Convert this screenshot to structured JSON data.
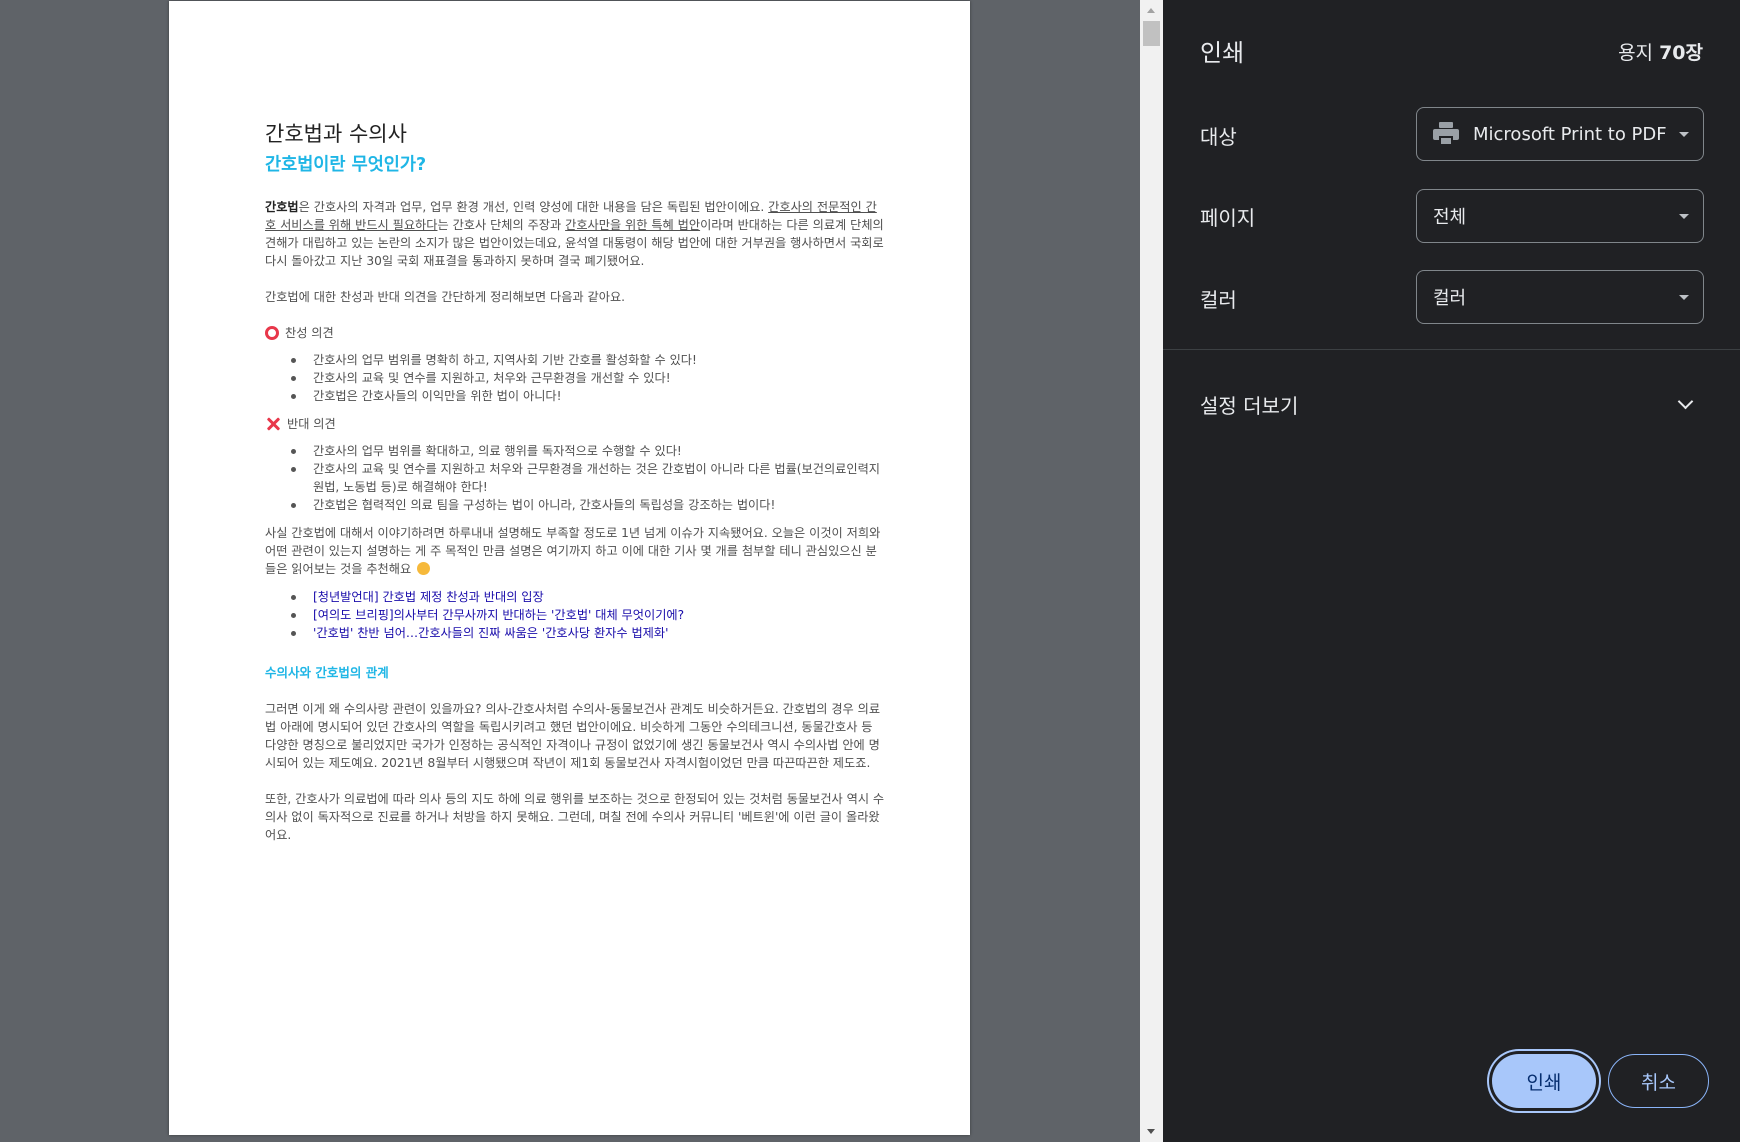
{
  "document": {
    "title": "간호법과 수의사",
    "heading": "간호법이란 무엇인가?",
    "intro": {
      "bold_term": "간호법",
      "part1": "은 간호사의 자격과 업무, 업무 환경 개선, 인력 양성에 대한 내용을 담은 독립된 법안이에요. ",
      "link1": "간호사의 전문적인 간호 서비스를 위해 반드시 필요하다",
      "part2": "는 간호사 단체의 주장과 ",
      "link2": "간호사만을 위한 특혜 법안",
      "part3": "이라며 반대하는 다른 의료계 단체의 견해가 대립하고 있는 논란의 소지가 많은 법안이었는데요, 윤석열 대통령이 해당 법안에 대한 거부권을 행사하면서 국회로 다시 돌아갔고 지난 30일 국회 재표결을 통과하지 못하며 결국 폐기됐어요."
    },
    "summary": "간호법에 대한 찬성과 반대 의견을 간단하게 정리해보면 다음과 같아요.",
    "pro_heading": "찬성 의견",
    "pro_items": [
      "간호사의 업무 범위를 명확히 하고, 지역사회 기반 간호를 활성화할 수 있다!",
      "간호사의 교육 및 연수를 지원하고, 처우와 근무환경을 개선할 수 있다!",
      "간호법은 간호사들의 이익만을 위한 법이 아니다!"
    ],
    "con_heading": "반대 의견",
    "con_items": [
      "간호사의 업무 범위를 확대하고, 의료 행위를 독자적으로 수행할 수 있다!",
      "간호사의 교육 및 연수를 지원하고 처우와 근무환경을 개선하는 것은 간호법이 아니라 다른 법률(보건의료인력지원법, 노동법 등)로 해결해야 한다!",
      "간호법은 협력적인 의료 팀을 구성하는 법이 아니라, 간호사들의 독립성을 강조하는 법이다!"
    ],
    "more_para": "사실 간호법에 대해서 이야기하려면 하루내내 설명해도 부족할 정도로 1년 넘게 이슈가 지속됐어요. 오늘은 이것이 저희와 어떤 관련이 있는지 설명하는 게 주 목적인 만큼 설명은 여기까지 하고 이에 대한 기사 몇 개를 첨부할 테니 관심있으신 분들은 읽어보는 것을 추천해요",
    "article_links": [
      "[청년발언대] 간호법 제정 찬성과 반대의 입장",
      "[여의도 브리핑]의사부터 간무사까지 반대하는 '간호법' 대체 무엇이기에?",
      "'간호법' 찬반 넘어…간호사들의 진짜 싸움은 '간호사당 환자수 법제화'"
    ],
    "section2_heading": "수의사와 간호법의 관계",
    "section2_para1": "그러면 이게 왜 수의사랑 관련이 있을까요? 의사-간호사처럼 수의사-동물보건사 관계도 비슷하거든요. 간호법의 경우 의료법 아래에 명시되어 있던 간호사의 역할을 독립시키려고 했던 법안이에요. 비슷하게 그동안 수의테크니션, 동물간호사 등 다양한 명칭으로 불리었지만 국가가 인정하는 공식적인 자격이나 규정이 없었기에 생긴 동물보건사 역시 수의사법 안에 명시되어 있는 제도예요. 2021년 8월부터 시행됐으며 작년이 제1회 동물보건사 자격시험이었던 만큼 따끈따끈한 제도죠.",
    "section2_para2": "또한, 간호사가 의료법에 따라 의사 등의 지도 하에 의료 행위를 보조하는 것으로 한정되어 있는 것처럼 동물보건사 역시 수의사 없이 독자적으로 진료를 하거나 처방을 하지 못해요. 그런데, 며칠 전에 수의사 커뮤니티 '베트윈'에 이런 글이 올라왔어요."
  },
  "panel": {
    "title": "인쇄",
    "sheet_prefix": "용지 ",
    "sheet_count": "70장",
    "destination_label": "대상",
    "destination_value": "Microsoft Print to PDF",
    "pages_label": "페이지",
    "pages_value": "전체",
    "color_label": "컬러",
    "color_value": "컬러",
    "more_settings": "설정 더보기",
    "print_button": "인쇄",
    "cancel_button": "취소"
  },
  "icons": {
    "destination": "printer-icon",
    "more_settings": "chevron-down-icon",
    "pro_mark": "circle-o-icon",
    "con_mark": "cross-x-icon",
    "emoji": "smiley-emoji-icon"
  },
  "colors": {
    "panel_bg": "#202124",
    "preview_bg": "#5f6368",
    "heading_accent": "#1fb6e6",
    "link": "#1a0dab",
    "print_button": "#a8c7fa",
    "mark_red": "#e8374a"
  }
}
